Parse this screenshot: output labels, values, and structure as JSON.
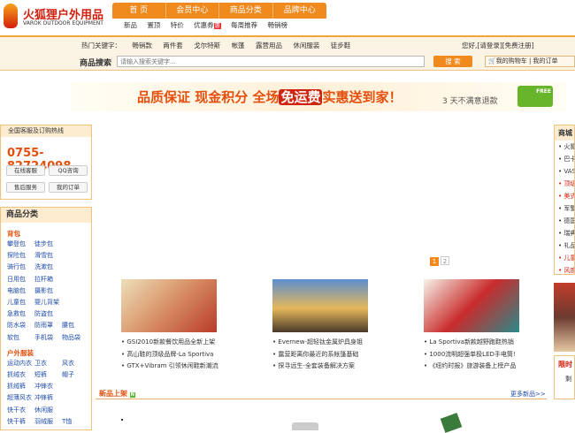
{
  "site": {
    "name_cn": "火狐狸户外用品",
    "name_en": "VAROK OUTDOOR EQUIPMENT"
  },
  "nav": [
    "首 页",
    "会员中心",
    "商品分类",
    "品牌中心"
  ],
  "subnav": [
    "新品",
    "置顶",
    "特价",
    "优惠券",
    "每周推荐",
    "畅销榜"
  ],
  "subnav_badge": "惠",
  "hotkeys": {
    "label": "热门关键字：",
    "items": [
      "畅销款",
      "两件套",
      "戈尔特斯",
      "帐篷",
      "露营用品",
      "休闲服装",
      "徒步鞋"
    ]
  },
  "user": {
    "greeting": "您好,",
    "login": "[请登录]",
    "register": "[免费注册]"
  },
  "search": {
    "label": "商品搜索",
    "placeholder": "请输入搜索关键字…",
    "button": "搜 索"
  },
  "cart": {
    "cart_label": "我的购物车",
    "orders_label": "我的订单"
  },
  "banner": {
    "text": "品质保证  现金积分  全场",
    "free": "免运费",
    "text2": "实惠送到家！",
    "sub": "3 天不满意退款",
    "truck": "FREE"
  },
  "service": {
    "title": "全国客服及订购热线",
    "phone": "0755-82724098",
    "buttons": [
      "在线客服",
      "QQ咨询",
      "售后服务",
      "我的订单"
    ]
  },
  "category": {
    "title": "商品分类",
    "groups": [
      {
        "name": "背包",
        "items": [
          [
            "攀登包",
            "徒步包"
          ],
          [
            "探险包",
            "滑雪包"
          ],
          [
            "骑行包",
            "洗漱包"
          ],
          [
            "日用包",
            "拉杆箱"
          ],
          [
            "电脑包",
            "摄影包"
          ],
          [
            "儿童包",
            "婴儿背架"
          ],
          [
            "急救包",
            "防盗包"
          ],
          [
            "防水袋",
            "防雨罩",
            "腰包"
          ],
          [
            "软包",
            "手机袋",
            "物品袋"
          ]
        ]
      },
      {
        "name": "户外服装",
        "items": [
          [
            "运动内衣",
            "卫衣",
            "风衣"
          ],
          [
            "抓绒衣",
            "短裤",
            "帽子"
          ],
          [
            "抓绒裤",
            "冲锋衣"
          ],
          [
            "超薄风衣",
            "冲锋裤"
          ],
          [
            "快干衣",
            "休闲服"
          ],
          [
            "快干裤",
            "羽绒服",
            "T恤"
          ]
        ]
      }
    ]
  },
  "pager": [
    "1",
    "2"
  ],
  "news": [
    {
      "lines": [
        "GSI2010新款餐饮用品全新上架",
        "高山鞋的顶级品牌-La Sportiva",
        "GTX+Vibram 引领休闲鞋新潮流"
      ]
    },
    {
      "lines": [
        "Evernew-超轻钛金属炉具身姐",
        "露营距离你最近的系帐篷基础",
        "探寻远生-全套装备解决方案"
      ]
    },
    {
      "lines": [
        "La Sportiva新款越野跑鞋热销",
        "1000流明超强单极LED手电筒!",
        "《纽约时报》旅游装备上榜产品"
      ]
    }
  ],
  "new_products": {
    "title": "新品上架",
    "badge": "N",
    "more": "更多新品>>"
  },
  "right": {
    "title": "商城",
    "items": [
      "火狐",
      "巴卡",
      "VAS",
      "顶级",
      "美式",
      "军警",
      "德国",
      "瑞典",
      "礼品",
      "儿童",
      "风度"
    ],
    "limit_title": "限时",
    "limit_sub": "剩"
  },
  "colors": {
    "accent": "#f08a1e",
    "brand_red": "#d2200f",
    "link": "#1d4aa8",
    "panel": "#fdecd0"
  }
}
